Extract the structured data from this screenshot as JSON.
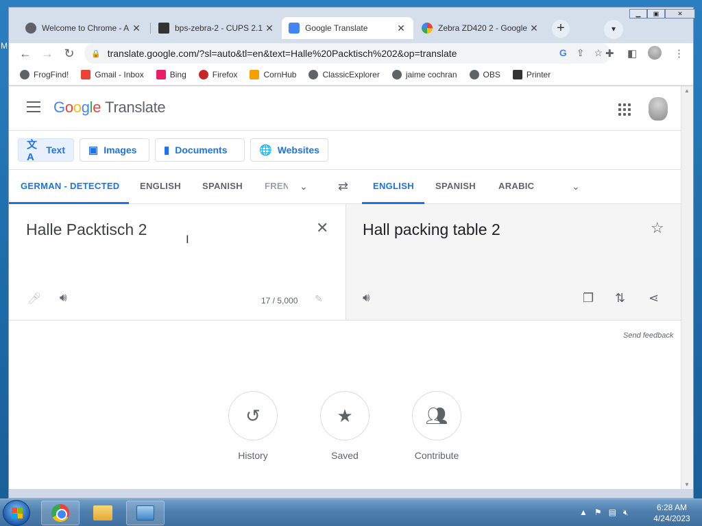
{
  "desktop": {
    "edge_letter": "M"
  },
  "browser": {
    "tabs": [
      {
        "title": "Welcome to Chrome - A",
        "favicon": "globe-icon",
        "active": false
      },
      {
        "title": "bps-zebra-2 - CUPS 2.1",
        "favicon": "cups-icon",
        "active": false
      },
      {
        "title": "Google Translate",
        "favicon": "translate-icon",
        "active": true
      },
      {
        "title": "Zebra ZD420 2 - Google",
        "favicon": "google-icon",
        "active": false
      }
    ],
    "new_tab": "+",
    "url": "translate.google.com/?sl=auto&tl=en&text=Halle%20Packtisch%202&op=translate",
    "bookmarks": [
      {
        "label": "FrogFind!",
        "icon": "globe-icon"
      },
      {
        "label": "Gmail - Inbox",
        "icon": "gmail-icon"
      },
      {
        "label": "Bing",
        "icon": "sky-icon"
      },
      {
        "label": "Firefox",
        "icon": "firefox-icon"
      },
      {
        "label": "CornHub",
        "icon": "ch-icon"
      },
      {
        "label": "ClassicExplorer",
        "icon": "globe-icon"
      },
      {
        "label": "jaime cochran",
        "icon": "globe-icon"
      },
      {
        "label": "OBS",
        "icon": "globe-icon"
      },
      {
        "label": "Printer",
        "icon": "cups-icon"
      }
    ]
  },
  "translate": {
    "logo_google": "Google",
    "logo_product": "Translate",
    "modes": [
      {
        "label": "Text",
        "icon": "translate-icon",
        "active": true
      },
      {
        "label": "Images",
        "icon": "image-icon",
        "active": false
      },
      {
        "label": "Documents",
        "icon": "document-icon",
        "active": false
      },
      {
        "label": "Websites",
        "icon": "globe-icon",
        "active": false
      }
    ],
    "source_langs": [
      "GERMAN - DETECTED",
      "ENGLISH",
      "SPANISH",
      "FREN"
    ],
    "target_langs": [
      "ENGLISH",
      "SPANISH",
      "ARABIC"
    ],
    "source_text": "Halle Packtisch 2",
    "target_text": "Hall packing table 2",
    "char_count": "17 / 5,000",
    "send_feedback": "Send feedback",
    "bottom_actions": [
      {
        "label": "History",
        "icon": "history-icon"
      },
      {
        "label": "Saved",
        "icon": "star-icon"
      },
      {
        "label": "Contribute",
        "icon": "people-icon"
      }
    ],
    "colors": {
      "accent": "#1a73e8",
      "text": "#3c4043"
    }
  },
  "taskbar": {
    "time": "6:28 AM",
    "date": "4/24/2023"
  }
}
